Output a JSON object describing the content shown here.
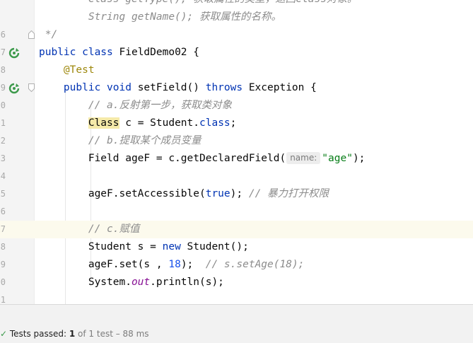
{
  "editor": {
    "gutter_numbers": [
      "",
      "",
      "6",
      "7",
      "8",
      "9",
      "0",
      "1",
      "2",
      "3",
      "4",
      "5",
      "6",
      "7",
      "8",
      "9",
      "0",
      "1"
    ],
    "lines": [
      {
        "indent": "        ",
        "tokens": [
          {
            "t": "Class getType(); ",
            "c": "cm"
          },
          {
            "t": "获取属性的类型，返回Class对象。",
            "c": "cm"
          }
        ]
      },
      {
        "indent": "        ",
        "tokens": [
          {
            "t": "String getName(); ",
            "c": "cm"
          },
          {
            "t": "获取属性的名称。",
            "c": "cm"
          }
        ]
      },
      {
        "indent": " ",
        "tokens": [
          {
            "t": "*/",
            "c": "cm"
          }
        ]
      },
      {
        "indent": "",
        "tokens": [
          {
            "t": "public class ",
            "c": "kw"
          },
          {
            "t": "FieldDemo02 {",
            "c": ""
          }
        ]
      },
      {
        "indent": "    ",
        "tokens": [
          {
            "t": "@Test",
            "c": "an"
          }
        ]
      },
      {
        "indent": "    ",
        "tokens": [
          {
            "t": "public void ",
            "c": "kw"
          },
          {
            "t": "setField() ",
            "c": ""
          },
          {
            "t": "throws ",
            "c": "kw"
          },
          {
            "t": "Exception {",
            "c": ""
          }
        ]
      },
      {
        "indent": "        ",
        "tokens": [
          {
            "t": "// a.反射第一步，获取类对象",
            "c": "cm"
          }
        ]
      },
      {
        "indent": "        ",
        "tokens": [
          {
            "t": "Class",
            "c": "hl"
          },
          {
            "t": " c = Student.",
            "c": ""
          },
          {
            "t": "class",
            "c": "kw"
          },
          {
            "t": ";",
            "c": ""
          }
        ]
      },
      {
        "indent": "        ",
        "tokens": [
          {
            "t": "// b.提取某个成员变量",
            "c": "cm"
          }
        ]
      },
      {
        "indent": "        ",
        "tokens": [
          {
            "t": "Field ageF = c.getDeclaredField(",
            "c": ""
          },
          {
            "t": "name:",
            "c": "hint"
          },
          {
            "t": "\"age\"",
            "c": "st"
          },
          {
            "t": ");",
            "c": ""
          }
        ]
      },
      {
        "indent": "",
        "tokens": []
      },
      {
        "indent": "        ",
        "tokens": [
          {
            "t": "ageF.setAccessible(",
            "c": ""
          },
          {
            "t": "true",
            "c": "kw"
          },
          {
            "t": "); ",
            "c": ""
          },
          {
            "t": "// 暴力打开权限",
            "c": "cm"
          }
        ]
      },
      {
        "indent": "",
        "tokens": []
      },
      {
        "indent": "        ",
        "tokens": [
          {
            "t": "// c.赋值",
            "c": "cm"
          }
        ]
      },
      {
        "indent": "        ",
        "tokens": [
          {
            "t": "Student s = ",
            "c": ""
          },
          {
            "t": "new ",
            "c": "kw"
          },
          {
            "t": "Student();",
            "c": ""
          }
        ]
      },
      {
        "indent": "        ",
        "tokens": [
          {
            "t": "ageF.set(s , ",
            "c": ""
          },
          {
            "t": "18",
            "c": "nm"
          },
          {
            "t": ");  ",
            "c": ""
          },
          {
            "t": "// s.setAge(18);",
            "c": "cm"
          }
        ]
      },
      {
        "indent": "        ",
        "tokens": [
          {
            "t": "System.",
            "c": ""
          },
          {
            "t": "out",
            "c": "fl"
          },
          {
            "t": ".println(s);",
            "c": ""
          }
        ]
      },
      {
        "indent": "",
        "tokens": []
      }
    ]
  },
  "status": {
    "prefix": "Tests passed: ",
    "passed": "1",
    "detail": " of 1 test – 88 ms"
  },
  "colors": {
    "keyword": "#0033b3",
    "comment": "#8c8c8c",
    "string": "#067d17",
    "number": "#1750eb",
    "annotation": "#9e880d",
    "static_field": "#871094",
    "run_icon": "#3c9a4b"
  }
}
